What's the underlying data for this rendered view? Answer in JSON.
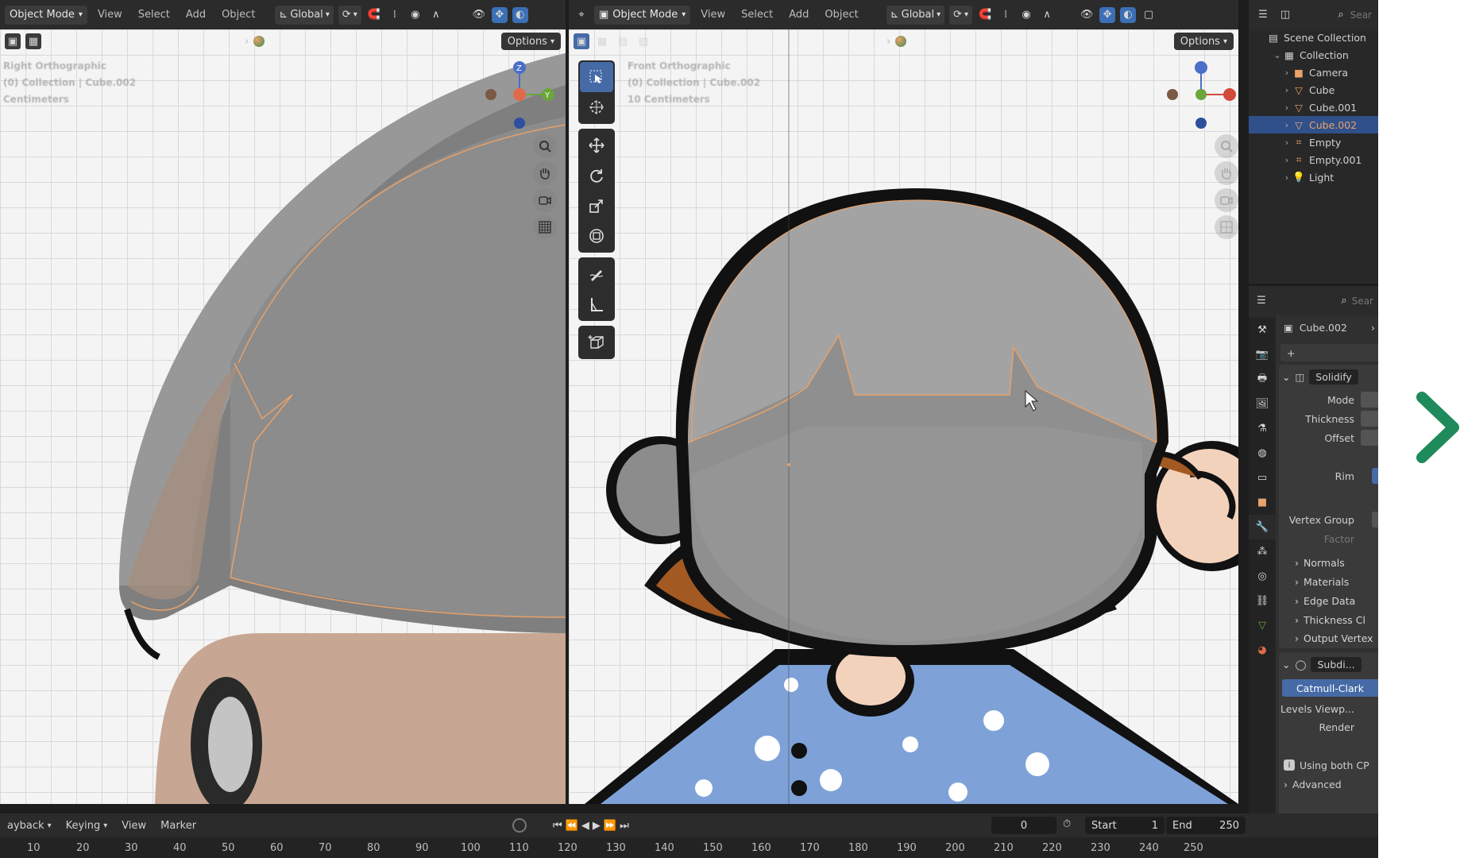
{
  "left_header": {
    "mode": "Object Mode",
    "menus": [
      "View",
      "Select",
      "Add",
      "Object"
    ],
    "transform_orientation": "Global",
    "options": "Options"
  },
  "right_header": {
    "mode": "Object Mode",
    "menus": [
      "View",
      "Select",
      "Add",
      "Object"
    ],
    "transform_orientation": "Global",
    "options": "Options"
  },
  "left_viewport": {
    "info": [
      "Right Orthographic",
      "(0) Collection | Cube.002",
      "Centimeters"
    ]
  },
  "right_viewport": {
    "info": [
      "Front Orthographic",
      "(0) Collection | Cube.002",
      "10 Centimeters"
    ]
  },
  "gizmo_axes": {
    "z": "Z",
    "y": "Y"
  },
  "outliner": {
    "search": "Sear",
    "scene_collection": "Scene Collection",
    "collection": "Collection",
    "items": [
      "Camera",
      "Cube",
      "Cube.001",
      "Cube.002",
      "Empty",
      "Empty.001",
      "Light"
    ],
    "selected_index": 3
  },
  "properties": {
    "search": "Sear",
    "object_name": "Cube.002",
    "add_modifier": "+",
    "solidify": {
      "name": "Solidify",
      "fields": [
        "Mode",
        "Thickness",
        "Offset",
        "Rim",
        "Vertex Group",
        "Factor"
      ],
      "subpanels": [
        "Normals",
        "Materials",
        "Edge Data",
        "Thickness Cl",
        "Output Vertex"
      ]
    },
    "subdivision": {
      "name": "Subdi...",
      "type": "Catmull-Clark",
      "fields": [
        "Levels Viewp...",
        "Render"
      ],
      "note": "Using both CP",
      "advanced": "Advanced"
    }
  },
  "timeline": {
    "menus": [
      "ayback",
      "Keying",
      "View",
      "Marker"
    ],
    "current_frame": "0",
    "start_label": "Start",
    "start": "1",
    "end_label": "End",
    "end": "250",
    "ticks": [
      "10",
      "20",
      "30",
      "40",
      "50",
      "60",
      "70",
      "80",
      "90",
      "100",
      "110",
      "120",
      "130",
      "140",
      "150",
      "160",
      "170",
      "180",
      "190",
      "200",
      "210",
      "220",
      "230",
      "240",
      "250"
    ]
  },
  "colors": {
    "accent_blue": "#456aa6",
    "selection_orange": "#e8a26a",
    "hair_gray": "#9a9a9a",
    "next_arrow": "#1f8a5b"
  }
}
